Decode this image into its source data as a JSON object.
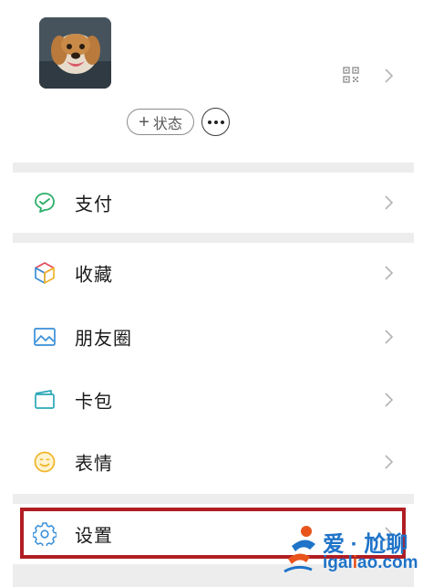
{
  "profile": {
    "status_label": "状态",
    "more_label": "···"
  },
  "menu": {
    "pay": "支付",
    "favorites": "收藏",
    "moments": "朋友圈",
    "cards": "卡包",
    "stickers": "表情",
    "settings": "设置"
  },
  "watermark": {
    "brand": "爱 · 尬聊",
    "site_prefix": "igal",
    "site_o": "i",
    "site_suffix": "ao.com"
  },
  "colors": {
    "pay_icon": "#2aae67",
    "highlight_border": "#b01e24",
    "watermark": "#1f73c8"
  }
}
